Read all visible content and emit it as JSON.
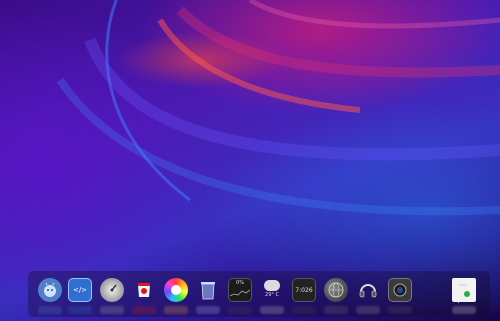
{
  "dock": {
    "items": [
      {
        "icon": "android-robot-icon"
      },
      {
        "icon": "code-editor-icon",
        "label": "</>"
      },
      {
        "icon": "gauge-icon"
      },
      {
        "icon": "scarlett-cup-icon"
      },
      {
        "icon": "color-wheel-icon"
      },
      {
        "icon": "trash-icon"
      },
      {
        "icon": "system-monitor-icon",
        "label": "0%"
      },
      {
        "icon": "weather-icon",
        "label": "29° C"
      },
      {
        "icon": "clock-widget-icon",
        "label": "7:026"
      },
      {
        "icon": "network-globe-icon"
      },
      {
        "icon": "headset-icon"
      },
      {
        "icon": "camera-icon"
      },
      {
        "icon": "notes-icon"
      }
    ]
  },
  "colors": {
    "accent_red": "#ff4a3c",
    "accent_blue": "#2f6fe6",
    "base_purple": "#3a0c8a"
  }
}
